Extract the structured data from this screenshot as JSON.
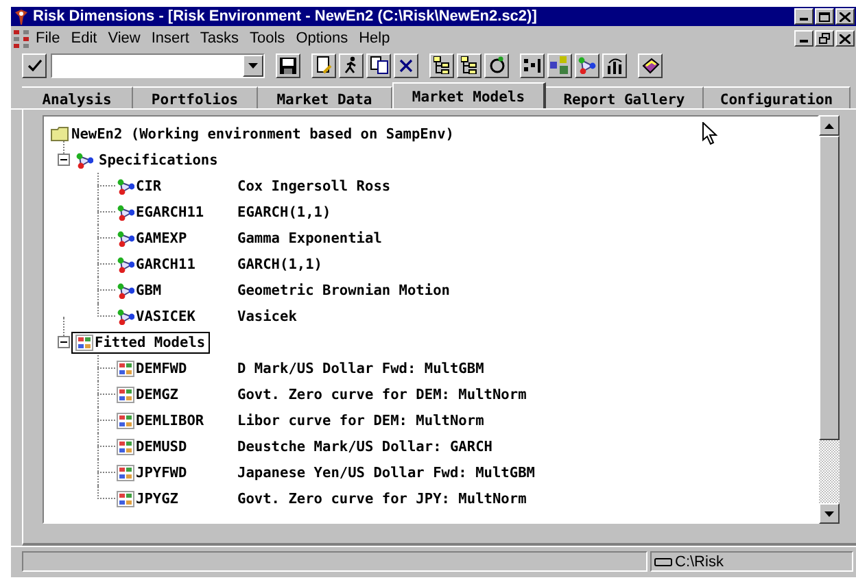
{
  "window": {
    "title": "Risk Dimensions - [Risk Environment - NewEn2 (C:\\Risk\\NewEn2.sc2)]"
  },
  "menu": [
    {
      "label": "File"
    },
    {
      "label": "Edit"
    },
    {
      "label": "View"
    },
    {
      "label": "Insert"
    },
    {
      "label": "Tasks"
    },
    {
      "label": "Tools"
    },
    {
      "label": "Options"
    },
    {
      "label": "Help"
    }
  ],
  "tabs": [
    {
      "label": "Analysis",
      "selected": false
    },
    {
      "label": "Portfolios",
      "selected": false
    },
    {
      "label": "Market Data",
      "selected": false
    },
    {
      "label": "Market Models",
      "selected": true
    },
    {
      "label": "Report Gallery",
      "selected": false
    },
    {
      "label": "Configuration",
      "selected": false
    }
  ],
  "tree": {
    "label": "NewEn2 (Working environment based on SampEnv)",
    "kind": "folder",
    "selected": false,
    "children": [
      {
        "label": "Specifications",
        "kind": "specification",
        "expanded": true,
        "selected": false,
        "children": [
          {
            "label": "CIR",
            "description": "Cox Ingersoll Ross",
            "kind": "specification",
            "selected": false
          },
          {
            "label": "EGARCH11",
            "description": "EGARCH(1,1)",
            "kind": "specification",
            "selected": false
          },
          {
            "label": "GAMEXP",
            "description": "Gamma Exponential",
            "kind": "specification",
            "selected": false
          },
          {
            "label": "GARCH11",
            "description": "GARCH(1,1)",
            "kind": "specification",
            "selected": false
          },
          {
            "label": "GBM",
            "description": "Geometric Brownian Motion",
            "kind": "specification",
            "selected": false
          },
          {
            "label": "VASICEK",
            "description": "Vasicek",
            "kind": "specification",
            "selected": false
          }
        ]
      },
      {
        "label": "Fitted Models",
        "kind": "fitted",
        "expanded": true,
        "selected": true,
        "children": [
          {
            "label": "DEMFWD",
            "description": "D Mark/US Dollar Fwd: MultGBM",
            "kind": "fitted",
            "selected": false
          },
          {
            "label": "DEMGZ",
            "description": "Govt. Zero curve for DEM: MultNorm",
            "kind": "fitted",
            "selected": false
          },
          {
            "label": "DEMLIBOR",
            "description": "Libor curve for DEM: MultNorm",
            "kind": "fitted",
            "selected": false
          },
          {
            "label": "DEMUSD",
            "description": "Deustche Mark/US Dollar: GARCH",
            "kind": "fitted",
            "selected": false
          },
          {
            "label": "JPYFWD",
            "description": "Japanese Yen/US Dollar Fwd: MultGBM",
            "kind": "fitted",
            "selected": false
          },
          {
            "label": "JPYGZ",
            "description": "Govt. Zero curve for JPY: MultNorm",
            "kind": "fitted",
            "selected": false
          }
        ]
      }
    ]
  },
  "status_bar": {
    "path": "C:\\Risk"
  }
}
